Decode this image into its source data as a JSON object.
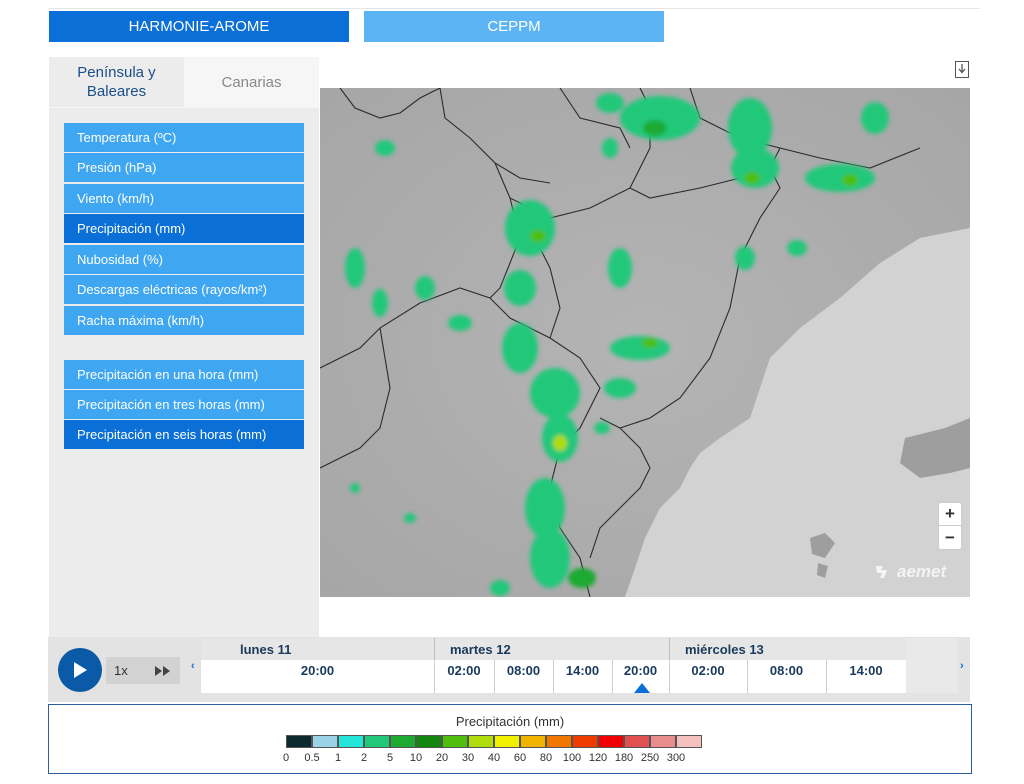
{
  "models": {
    "active": "HARMONIE-AROME",
    "inactive": "CEPPM"
  },
  "regions": {
    "active": "Península y Baleares",
    "inactive": "Canarias"
  },
  "variables": [
    {
      "label": "Temperatura (ºC)",
      "selected": false
    },
    {
      "label": "Presión (hPa)",
      "selected": false
    },
    {
      "label": "Viento (km/h)",
      "selected": false
    },
    {
      "label": "Precipitación (mm)",
      "selected": true
    },
    {
      "label": "Nubosidad (%)",
      "selected": false
    },
    {
      "label": "Descargas eléctricas (rayos/km²)",
      "selected": false
    },
    {
      "label": "Racha máxima (km/h)",
      "selected": false
    }
  ],
  "precip_options": [
    {
      "label": "Precipitación en una hora (mm)",
      "selected": false
    },
    {
      "label": "Precipitación en tres horas (mm)",
      "selected": false
    },
    {
      "label": "Precipitación en seis horas (mm)",
      "selected": true
    }
  ],
  "map": {
    "zoom_in": "+",
    "zoom_out": "−",
    "brand": "aemet"
  },
  "player": {
    "speed": "1x",
    "prev": "‹",
    "next": "›"
  },
  "timeline": {
    "days": [
      "lunes 11",
      "martes 12",
      "miércoles 13"
    ],
    "hours": [
      "20:00",
      "02:00",
      "08:00",
      "14:00",
      "20:00",
      "02:00",
      "08:00",
      "14:00"
    ],
    "current_index": 4
  },
  "legend": {
    "title": "Precipitación (mm)",
    "colors": [
      "#0c2a2e",
      "#9bd2e6",
      "#24e6d8",
      "#22c87a",
      "#1eaa32",
      "#12860e",
      "#4fbe0c",
      "#b0dc0c",
      "#f0f000",
      "#f0b400",
      "#f07800",
      "#f03c00",
      "#f00000",
      "#e05050",
      "#e88c8c",
      "#f4c0c0"
    ],
    "labels": [
      "0",
      "0.5",
      "1",
      "2",
      "5",
      "10",
      "20",
      "30",
      "40",
      "60",
      "80",
      "100",
      "120",
      "180",
      "250",
      "300"
    ]
  }
}
